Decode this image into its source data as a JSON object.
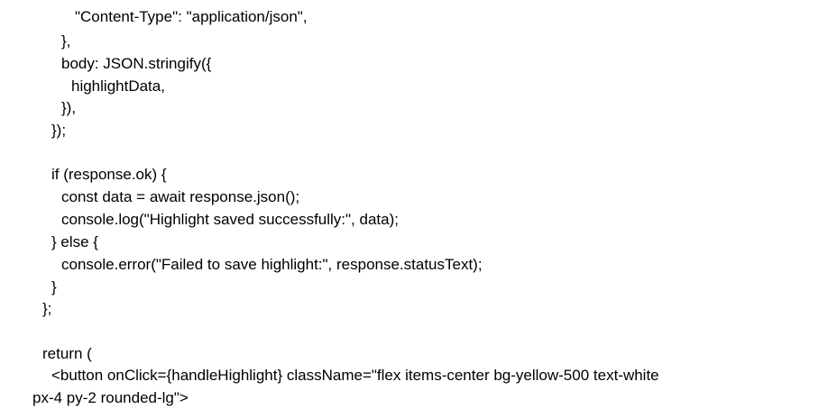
{
  "document": {
    "lines": [
      "\"Content-Type\": \"application/json\",",
      "},",
      "body: JSON.stringify({",
      "highlightData,",
      "}),",
      "});",
      "if (response.ok) {",
      "const data = await response.json();",
      "console.log(\"Highlight saved successfully:\", data);",
      "} else {",
      "console.error(\"Failed to save highlight:\", response.statusText);",
      "}",
      "};",
      "return (",
      "<button onClick={handleHighlight} className=\"flex items-center bg-yellow-500 text-white",
      "px-4 py-2 rounded-lg\">"
    ]
  }
}
